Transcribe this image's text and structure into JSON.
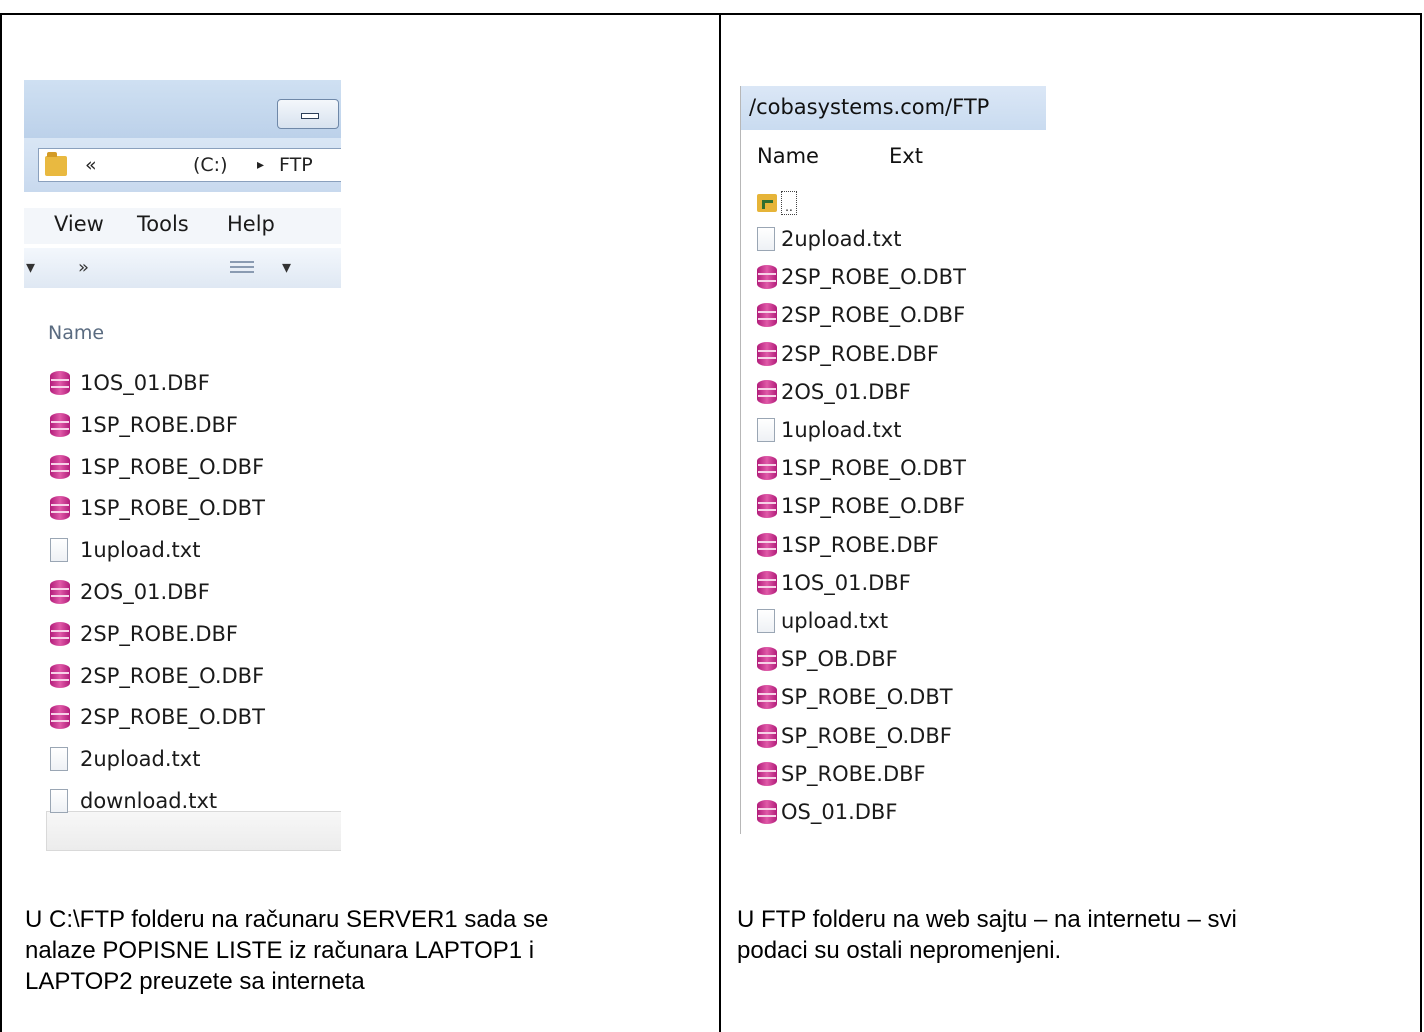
{
  "explorer": {
    "address": {
      "chevrons": "«",
      "drive": "(C:)",
      "arrow": "▸",
      "folder": "FTP"
    },
    "menu": {
      "view": "View",
      "tools": "Tools",
      "help": "Help"
    },
    "toolbar": {
      "dropdown": "▾",
      "more": "»",
      "view_dropdown": "▾"
    },
    "column_name": "Name",
    "files": [
      {
        "name": "1OS_01.DBF",
        "type": "dbf"
      },
      {
        "name": "1SP_ROBE.DBF",
        "type": "dbf"
      },
      {
        "name": "1SP_ROBE_O.DBF",
        "type": "dbf"
      },
      {
        "name": "1SP_ROBE_O.DBT",
        "type": "dbf"
      },
      {
        "name": "1upload.txt",
        "type": "txt"
      },
      {
        "name": "2OS_01.DBF",
        "type": "dbf"
      },
      {
        "name": "2SP_ROBE.DBF",
        "type": "dbf"
      },
      {
        "name": "2SP_ROBE_O.DBF",
        "type": "dbf"
      },
      {
        "name": "2SP_ROBE_O.DBT",
        "type": "dbf"
      },
      {
        "name": "2upload.txt",
        "type": "txt"
      },
      {
        "name": "download.txt",
        "type": "txt"
      }
    ]
  },
  "ftp": {
    "path": "/cobasystems.com/FTP",
    "columns": {
      "name": "Name",
      "ext": "Ext"
    },
    "parent_label": "..",
    "files": [
      {
        "name": "2upload.txt",
        "type": "txt"
      },
      {
        "name": "2SP_ROBE_O.DBT",
        "type": "dbf"
      },
      {
        "name": "2SP_ROBE_O.DBF",
        "type": "dbf"
      },
      {
        "name": "2SP_ROBE.DBF",
        "type": "dbf"
      },
      {
        "name": "2OS_01.DBF",
        "type": "dbf"
      },
      {
        "name": "1upload.txt",
        "type": "txt"
      },
      {
        "name": "1SP_ROBE_O.DBT",
        "type": "dbf"
      },
      {
        "name": "1SP_ROBE_O.DBF",
        "type": "dbf"
      },
      {
        "name": "1SP_ROBE.DBF",
        "type": "dbf"
      },
      {
        "name": "1OS_01.DBF",
        "type": "dbf"
      },
      {
        "name": "upload.txt",
        "type": "txt"
      },
      {
        "name": "SP_OB.DBF",
        "type": "dbf"
      },
      {
        "name": "SP_ROBE_O.DBT",
        "type": "dbf"
      },
      {
        "name": "SP_ROBE_O.DBF",
        "type": "dbf"
      },
      {
        "name": "SP_ROBE.DBF",
        "type": "dbf"
      },
      {
        "name": "OS_01.DBF",
        "type": "dbf"
      }
    ]
  },
  "captions": {
    "left": [
      "U C:\\FTP folderu na računaru SERVER1 sada se",
      "nalaze POPISNE LISTE iz računara LAPTOP1 i",
      "LAPTOP2 preuzete sa interneta"
    ],
    "right": [
      "U FTP folderu na web sajtu – na internetu – svi",
      "podaci su ostali nepromenjeni."
    ]
  }
}
